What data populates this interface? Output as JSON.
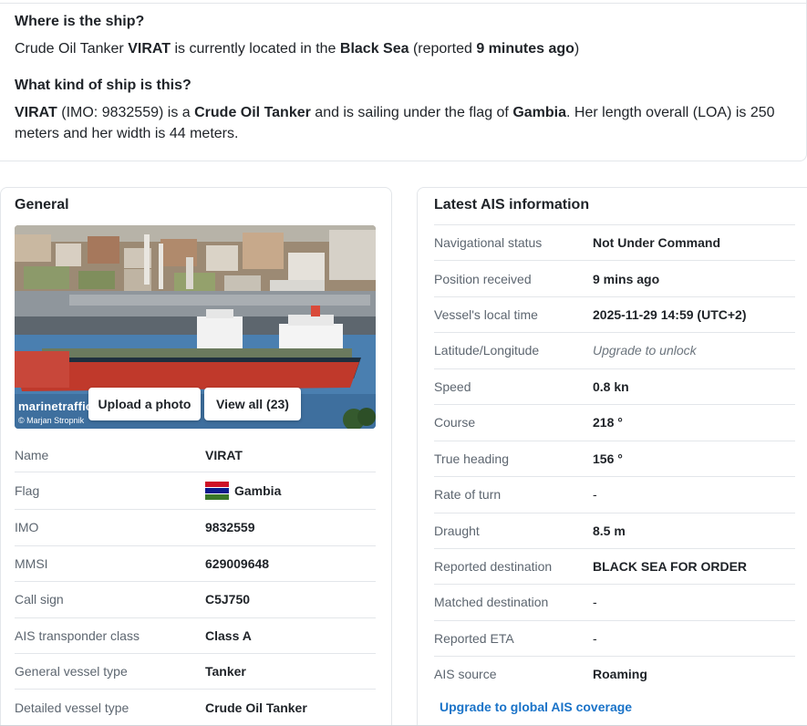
{
  "summary": {
    "where_title": "Where is the ship?",
    "where": {
      "p1": "Crude Oil Tanker ",
      "ship": "VIRAT",
      "p2": " is currently located in the ",
      "sea": "Black Sea",
      "p3": " (reported ",
      "ago": "9 minutes ago",
      "p4": ")"
    },
    "kind_title": "What kind of ship is this?",
    "kind": {
      "ship": "VIRAT",
      "p1": " (IMO: 9832559) is a ",
      "type": "Crude Oil Tanker",
      "p2": " and is sailing under the flag of ",
      "flag": "Gambia",
      "p3": ". Her length overall (LOA) is 250 meters and her width is 44 meters."
    }
  },
  "general": {
    "title": "General",
    "photo": {
      "watermark": "marinetraffic",
      "credit": "© Marjan Stropnik",
      "upload_label": "Upload a photo",
      "view_all_label": "View all (23)"
    },
    "rows": [
      {
        "label": "Name",
        "value": "VIRAT"
      },
      {
        "label": "Flag",
        "value": "Gambia"
      },
      {
        "label": "IMO",
        "value": "9832559"
      },
      {
        "label": "MMSI",
        "value": "629009648"
      },
      {
        "label": "Call sign",
        "value": "C5J750"
      },
      {
        "label": "AIS transponder class",
        "value": "Class A"
      },
      {
        "label": "General vessel type",
        "value": "Tanker"
      },
      {
        "label": "Detailed vessel type",
        "value": "Crude Oil Tanker"
      }
    ]
  },
  "ais": {
    "title": "Latest AIS information",
    "rows": [
      {
        "label": "Navigational status",
        "value": "Not Under Command"
      },
      {
        "label": "Position received",
        "value": "9 mins ago"
      },
      {
        "label": "Vessel's local time",
        "value": "2025-11-29 14:59 (UTC+2)"
      },
      {
        "label": "Latitude/Longitude",
        "value": "Upgrade to unlock"
      },
      {
        "label": "Speed",
        "value": "0.8 kn"
      },
      {
        "label": "Course",
        "value": "218 °"
      },
      {
        "label": "True heading",
        "value": "156 °"
      },
      {
        "label": "Rate of turn",
        "value": "-"
      },
      {
        "label": "Draught",
        "value": "8.5 m"
      },
      {
        "label": "Reported destination",
        "value": "BLACK SEA FOR ORDER"
      },
      {
        "label": "Matched destination",
        "value": "-"
      },
      {
        "label": "Reported ETA",
        "value": "-"
      },
      {
        "label": "AIS source",
        "value": "Roaming"
      }
    ],
    "upgrade_link": "Upgrade to global AIS coverage"
  },
  "colors": {
    "link": "#1a73c8",
    "hull": "#c0392b",
    "water": "#4a7fb0"
  }
}
